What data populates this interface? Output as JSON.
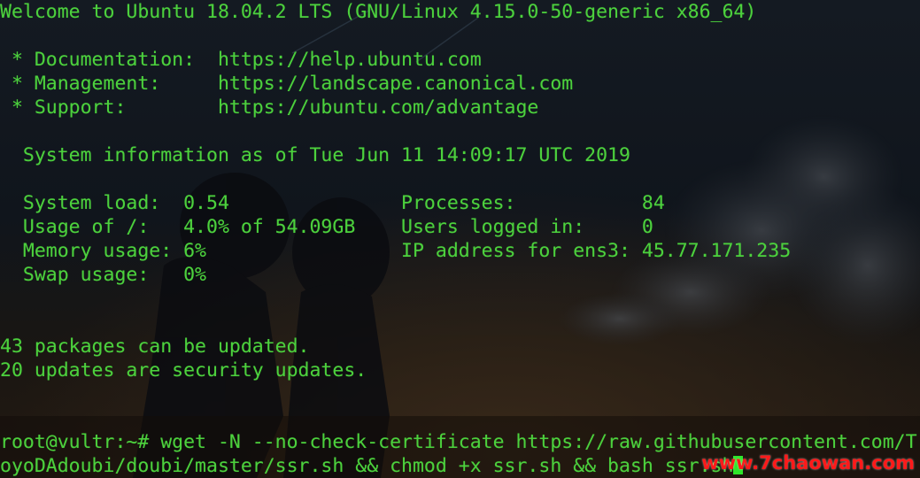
{
  "terminal": {
    "lines": [
      "Welcome to Ubuntu 18.04.2 LTS (GNU/Linux 4.15.0-50-generic x86_64)",
      "",
      " * Documentation:  https://help.ubuntu.com",
      " * Management:     https://landscape.canonical.com",
      " * Support:        https://ubuntu.com/advantage",
      "",
      "  System information as of Tue Jun 11 14:09:17 UTC 2019",
      "",
      "  System load:  0.54               Processes:           84",
      "  Usage of /:   4.0% of 54.09GB    Users logged in:     0",
      "  Memory usage: 6%                 IP address for ens3: 45.77.171.235",
      "  Swap usage:   0%",
      "",
      "",
      "43 packages can be updated.",
      "20 updates are security updates.",
      "",
      "",
      "root@vultr:~# wget -N --no-check-certificate https://raw.githubusercontent.com/T",
      "oyoDAdoubi/doubi/master/ssr.sh && chmod +x ssr.sh && bash ssr.sh"
    ]
  },
  "watermark": {
    "text": "www.7chaowan.com"
  },
  "colors": {
    "text": "#4cd13d",
    "cursor": "#2ee62a",
    "watermark": "#ff1a1a"
  }
}
